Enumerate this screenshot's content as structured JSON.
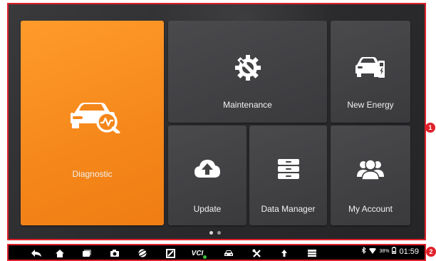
{
  "tiles": {
    "diagnostic": {
      "label": "Diagnostic",
      "icon": "car-diagnostic-icon"
    },
    "maintenance": {
      "label": "Maintenance",
      "icon": "gear-wrench-icon"
    },
    "new_energy": {
      "label": "New Energy",
      "icon": "ev-car-charging-icon"
    },
    "update": {
      "label": "Update",
      "icon": "cloud-upload-icon"
    },
    "data_manager": {
      "label": "Data Manager",
      "icon": "file-drawer-icon"
    },
    "my_account": {
      "label": "My Account",
      "icon": "users-icon"
    }
  },
  "pager": {
    "pages": 2,
    "current": 1
  },
  "navbar": {
    "buttons": [
      "back-icon",
      "home-icon",
      "recent-apps-icon",
      "camera-icon",
      "browser-icon",
      "screenshot-icon",
      "vci-icon",
      "car-icon",
      "tools-icon",
      "upload-icon",
      "menu-icon"
    ],
    "vci_label": "VCI",
    "battery": "38%",
    "time": "01:59"
  },
  "callouts": {
    "screen": "1",
    "navbar": "2"
  },
  "colors": {
    "accent": "#f5871a",
    "callout": "#e0212b",
    "tile": "#434346",
    "background": "#2e2e30"
  }
}
